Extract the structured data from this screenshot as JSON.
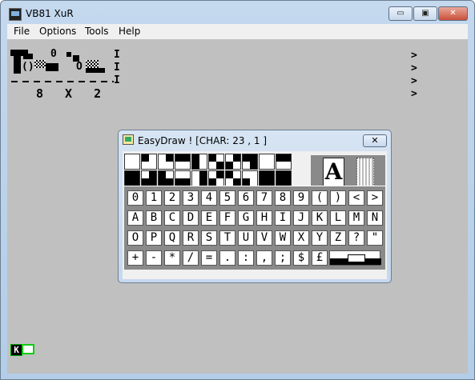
{
  "window": {
    "title": "VB81 XuR",
    "min_glyph": "▭",
    "max_glyph": "▣",
    "close_glyph": "✕"
  },
  "menu": [
    "File",
    "Options",
    "Tools",
    "Help"
  ],
  "screen": {
    "dims_text": "8 X 2",
    "sep_glyph": "I",
    "arrow_glyph": ">",
    "paren_text": "()",
    "zero_glyph": "0",
    "oh_glyph": "O"
  },
  "cursor": {
    "glyph": "K"
  },
  "dialog": {
    "title": "EasyDraw ! [CHAR: 23 , 1 ]",
    "close_glyph": "✕",
    "letter_glyph": "A",
    "rows": [
      [
        "0",
        "1",
        "2",
        "3",
        "4",
        "5",
        "6",
        "7",
        "8",
        "9",
        "(",
        ")",
        "<",
        ">"
      ],
      [
        "A",
        "B",
        "C",
        "D",
        "E",
        "F",
        "G",
        "H",
        "I",
        "J",
        "K",
        "L",
        "M",
        "N"
      ],
      [
        "O",
        "P",
        "Q",
        "R",
        "S",
        "T",
        "U",
        "V",
        "W",
        "X",
        "Y",
        "Z",
        "?",
        "\""
      ],
      [
        "+",
        "-",
        "*",
        "/",
        "=",
        ".",
        ":",
        ",",
        ";",
        "$",
        "£"
      ]
    ]
  }
}
